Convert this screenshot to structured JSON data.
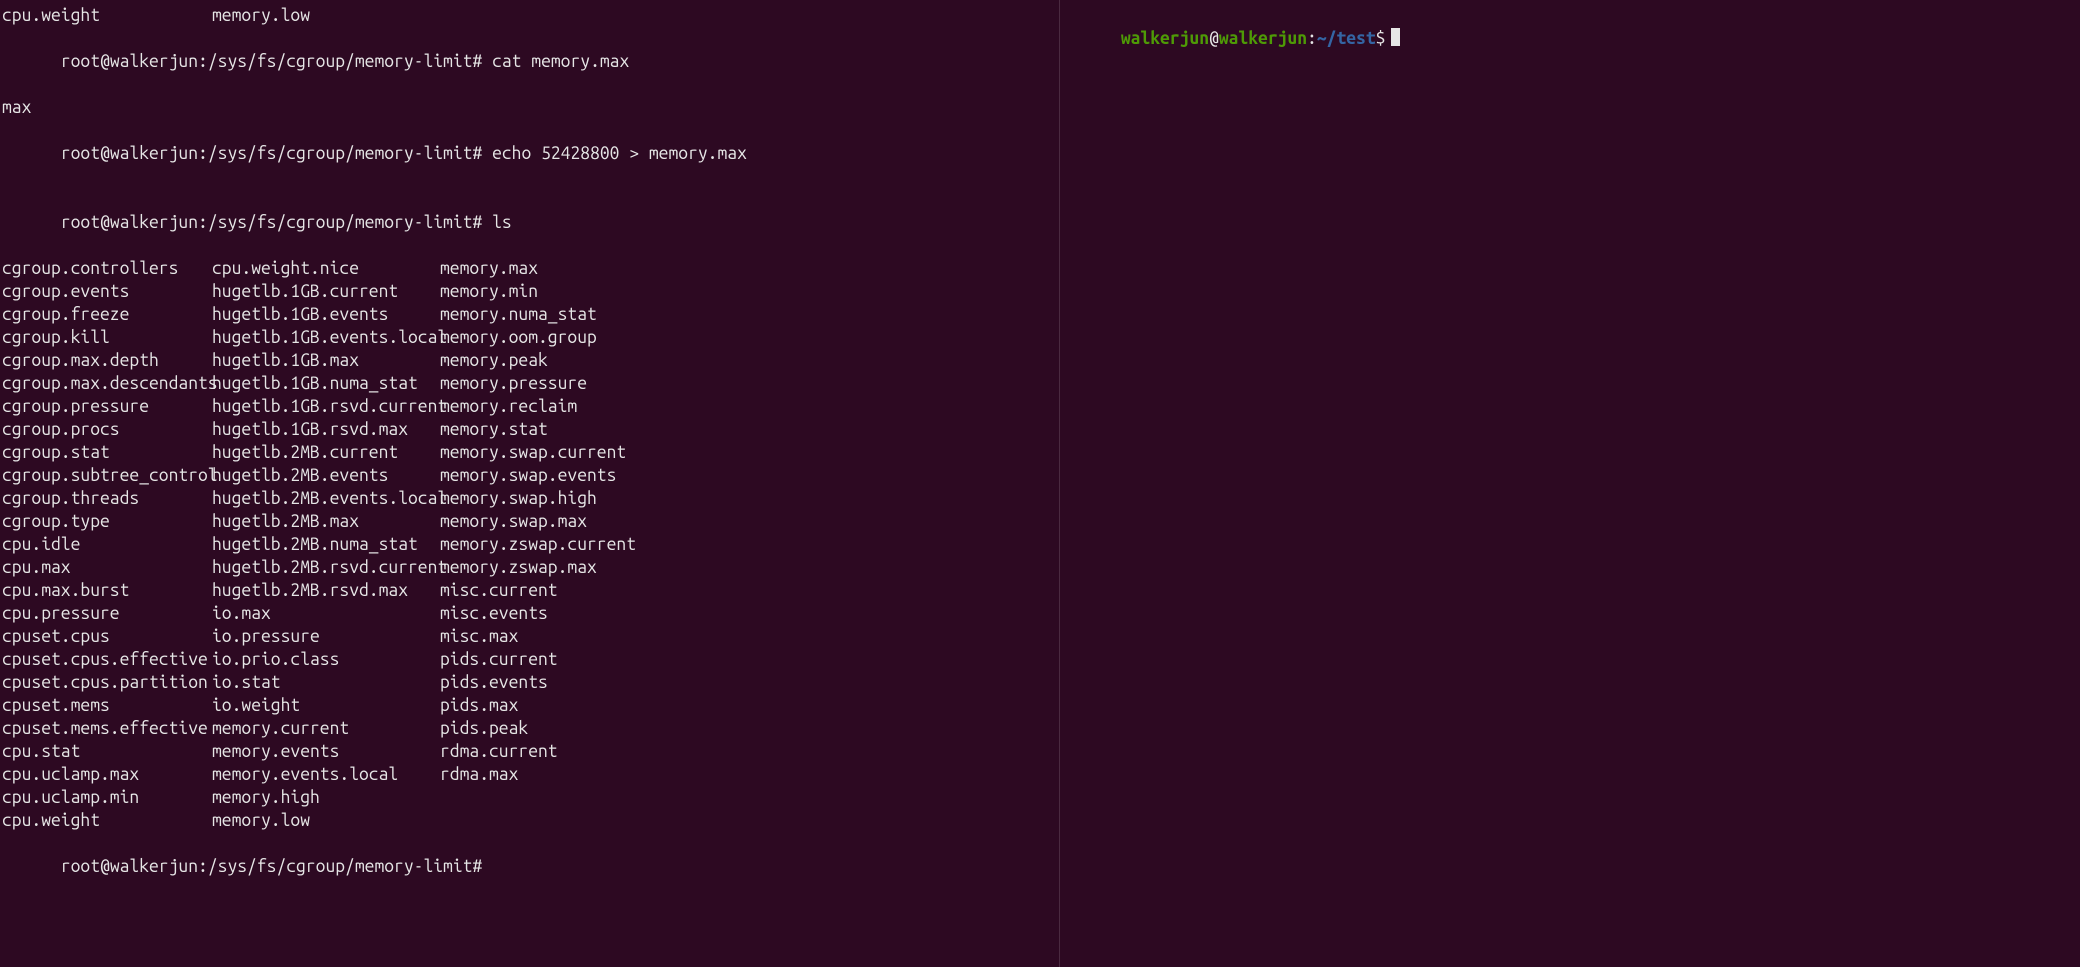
{
  "left": {
    "top_row": {
      "col1": "cpu.weight",
      "col2": "memory.low"
    },
    "prompt1": {
      "user": "root",
      "at": "@",
      "host": "walkerjun",
      "colon": ":",
      "path": "/sys/fs/cgroup/memory-limit",
      "hash": "#",
      "command": "cat memory.max"
    },
    "cat_output": "max",
    "prompt2": {
      "user": "root",
      "at": "@",
      "host": "walkerjun",
      "colon": ":",
      "path": "/sys/fs/cgroup/memory-limit",
      "hash": "#",
      "command": "echo 52428800 > memory.max"
    },
    "prompt3": {
      "user": "root",
      "at": "@",
      "host": "walkerjun",
      "colon": ":",
      "path": "/sys/fs/cgroup/memory-limit",
      "hash": "#",
      "command": "ls"
    },
    "ls": {
      "rows": [
        [
          "cgroup.controllers",
          "cpu.weight.nice",
          "memory.max"
        ],
        [
          "cgroup.events",
          "hugetlb.1GB.current",
          "memory.min"
        ],
        [
          "cgroup.freeze",
          "hugetlb.1GB.events",
          "memory.numa_stat"
        ],
        [
          "cgroup.kill",
          "hugetlb.1GB.events.local",
          "memory.oom.group"
        ],
        [
          "cgroup.max.depth",
          "hugetlb.1GB.max",
          "memory.peak"
        ],
        [
          "cgroup.max.descendants",
          "hugetlb.1GB.numa_stat",
          "memory.pressure"
        ],
        [
          "cgroup.pressure",
          "hugetlb.1GB.rsvd.current",
          "memory.reclaim"
        ],
        [
          "cgroup.procs",
          "hugetlb.1GB.rsvd.max",
          "memory.stat"
        ],
        [
          "cgroup.stat",
          "hugetlb.2MB.current",
          "memory.swap.current"
        ],
        [
          "cgroup.subtree_control",
          "hugetlb.2MB.events",
          "memory.swap.events"
        ],
        [
          "cgroup.threads",
          "hugetlb.2MB.events.local",
          "memory.swap.high"
        ],
        [
          "cgroup.type",
          "hugetlb.2MB.max",
          "memory.swap.max"
        ],
        [
          "cpu.idle",
          "hugetlb.2MB.numa_stat",
          "memory.zswap.current"
        ],
        [
          "cpu.max",
          "hugetlb.2MB.rsvd.current",
          "memory.zswap.max"
        ],
        [
          "cpu.max.burst",
          "hugetlb.2MB.rsvd.max",
          "misc.current"
        ],
        [
          "cpu.pressure",
          "io.max",
          "misc.events"
        ],
        [
          "cpuset.cpus",
          "io.pressure",
          "misc.max"
        ],
        [
          "cpuset.cpus.effective",
          "io.prio.class",
          "pids.current"
        ],
        [
          "cpuset.cpus.partition",
          "io.stat",
          "pids.events"
        ],
        [
          "cpuset.mems",
          "io.weight",
          "pids.max"
        ],
        [
          "cpuset.mems.effective",
          "memory.current",
          "pids.peak"
        ],
        [
          "cpu.stat",
          "memory.events",
          "rdma.current"
        ],
        [
          "cpu.uclamp.max",
          "memory.events.local",
          "rdma.max"
        ],
        [
          "cpu.uclamp.min",
          "memory.high",
          ""
        ],
        [
          "cpu.weight",
          "memory.low",
          ""
        ]
      ]
    },
    "prompt4": {
      "user": "root",
      "at": "@",
      "host": "walkerjun",
      "colon": ":",
      "path": "/sys/fs/cgroup/memory-limit",
      "hash": "#",
      "command": ""
    }
  },
  "right": {
    "prompt": {
      "user": "walkerjun",
      "at": "@",
      "host": "walkerjun",
      "colon": ":",
      "path": "~/test",
      "dollar": "$"
    }
  },
  "colors": {
    "bg": "#2d0922",
    "fg": "#e6e6e6",
    "user_host": "#4e9a06",
    "path": "#3465a4"
  }
}
